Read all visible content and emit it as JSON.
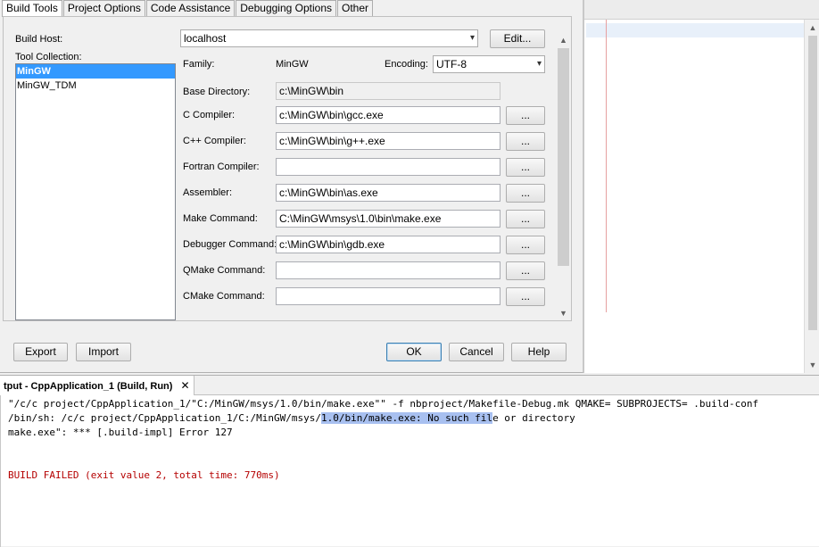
{
  "dialog": {
    "tabs": [
      {
        "label": "Build Tools",
        "active": true
      },
      {
        "label": "Project Options",
        "active": false
      },
      {
        "label": "Code Assistance",
        "active": false
      },
      {
        "label": "Debugging Options",
        "active": false
      },
      {
        "label": "Other",
        "active": false
      }
    ],
    "build_host": {
      "label": "Build Host:",
      "value": "localhost",
      "edit_button": "Edit..."
    },
    "tool_collection": {
      "label": "Tool Collection:",
      "items": [
        "MinGW",
        "MinGW_TDM"
      ],
      "selected": "MinGW"
    },
    "family": {
      "label": "Family:",
      "value": "MinGW"
    },
    "encoding": {
      "label": "Encoding:",
      "value": "UTF-8"
    },
    "base_directory": {
      "label": "Base Directory:",
      "value": "c:\\MinGW\\bin"
    },
    "fields": [
      {
        "label": "C Compiler:",
        "value": "c:\\MinGW\\bin\\gcc.exe",
        "browse": "..."
      },
      {
        "label": "C++ Compiler:",
        "value": "c:\\MinGW\\bin\\g++.exe",
        "browse": "..."
      },
      {
        "label": "Fortran Compiler:",
        "value": "",
        "browse": "..."
      },
      {
        "label": "Assembler:",
        "value": "c:\\MinGW\\bin\\as.exe",
        "browse": "..."
      },
      {
        "label": "Make Command:",
        "value": "C:\\MinGW\\msys\\1.0\\bin\\make.exe",
        "browse": "..."
      },
      {
        "label": "Debugger Command:",
        "value": "c:\\MinGW\\bin\\gdb.exe",
        "browse": "..."
      },
      {
        "label": "QMake Command:",
        "value": "",
        "browse": "..."
      },
      {
        "label": "CMake Command:",
        "value": "",
        "browse": "..."
      }
    ],
    "buttons": {
      "export": "Export",
      "import": "Import",
      "ok": "OK",
      "cancel": "Cancel",
      "help": "Help"
    }
  },
  "output": {
    "tab_title": "tput - CppApplication_1 (Build, Run)",
    "close_glyph": "✕",
    "lines": {
      "line1": "\"/c/c project/CppApplication_1/\"C:/MinGW/msys/1.0/bin/make.exe\"\" -f nbproject/Makefile-Debug.mk QMAKE= SUBPROJECTS= .build-conf",
      "line2_pre": "/bin/sh: /c/c project/CppApplication_1/C:/MinGW/msys/",
      "line2_hl": "1.0/bin/make.exe: No such fil",
      "line2_post": "e or directory",
      "line3": "make.exe\": *** [.build-impl] Error 127",
      "line4": "BUILD FAILED (exit value 2, total time: 770ms)"
    }
  },
  "icons": {
    "dropdown": "▾",
    "scroll_up": "▲",
    "scroll_down": "▼"
  }
}
